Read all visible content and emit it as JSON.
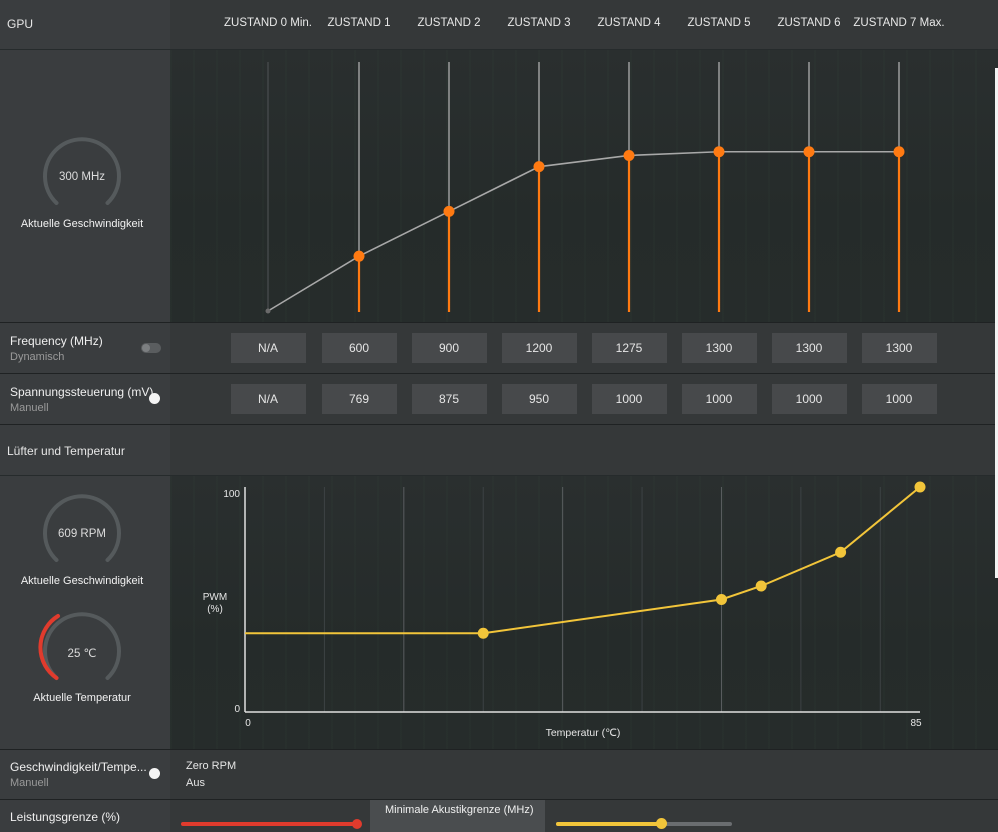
{
  "gpu": {
    "title": "GPU",
    "states": [
      "ZUSTAND 0 Min.",
      "ZUSTAND 1",
      "ZUSTAND 2",
      "ZUSTAND 3",
      "ZUSTAND 4",
      "ZUSTAND 5",
      "ZUSTAND 6",
      "ZUSTAND 7 Max."
    ],
    "speed_gauge": {
      "value": "300 MHz",
      "label": "Aktuelle Geschwindigkeit"
    },
    "frequency": {
      "title": "Frequency (MHz)",
      "mode": "Dynamisch",
      "values": [
        "N/A",
        "600",
        "900",
        "1200",
        "1275",
        "1300",
        "1300",
        "1300"
      ]
    },
    "voltage": {
      "title": "Spannungssteuerung (mV)",
      "mode": "Manuell",
      "values": [
        "N/A",
        "769",
        "875",
        "950",
        "1000",
        "1000",
        "1000",
        "1000"
      ]
    },
    "accent_color": "#ff7a12"
  },
  "fan": {
    "title": "Lüfter und Temperatur",
    "rpm_gauge": {
      "value": "609 RPM",
      "label": "Aktuelle Geschwindigkeit"
    },
    "temp_gauge": {
      "value": "25 ℃",
      "label": "Aktuelle Temperatur",
      "color": "#e03b2d"
    },
    "speed_temp": {
      "title": "Geschwindigkeit/Tempe...",
      "mode": "Manuell"
    },
    "zero_rpm": {
      "title": "Zero RPM",
      "value": "Aus"
    },
    "accent_color": "#f2c53a"
  },
  "power": {
    "title": "Leistungsgrenze (%)",
    "acoustic_title": "Minimale Akustikgrenze (MHz)",
    "power_slider_color": "#e03b2d",
    "acoustic_slider_color": "#f2c53a"
  },
  "chart_data": [
    {
      "type": "line",
      "title": "",
      "categories": [
        "ZUSTAND 0 Min.",
        "ZUSTAND 1",
        "ZUSTAND 2",
        "ZUSTAND 3",
        "ZUSTAND 4",
        "ZUSTAND 5",
        "ZUSTAND 6",
        "ZUSTAND 7 Max."
      ],
      "values": [
        300,
        600,
        900,
        1200,
        1275,
        1300,
        1300,
        1300
      ],
      "ylabel": "",
      "xlabel": ""
    },
    {
      "type": "line",
      "title": "",
      "xlabel": "Temperatur (℃)",
      "ylabel": "PWM (%)",
      "xlim": [
        0,
        85
      ],
      "ylim": [
        0,
        100
      ],
      "x_ticks": [
        "0",
        "85"
      ],
      "y_ticks": [
        "0",
        "100"
      ],
      "x": [
        0,
        30,
        60,
        65,
        75,
        85
      ],
      "y": [
        35,
        35,
        50,
        56,
        71,
        100
      ]
    }
  ]
}
